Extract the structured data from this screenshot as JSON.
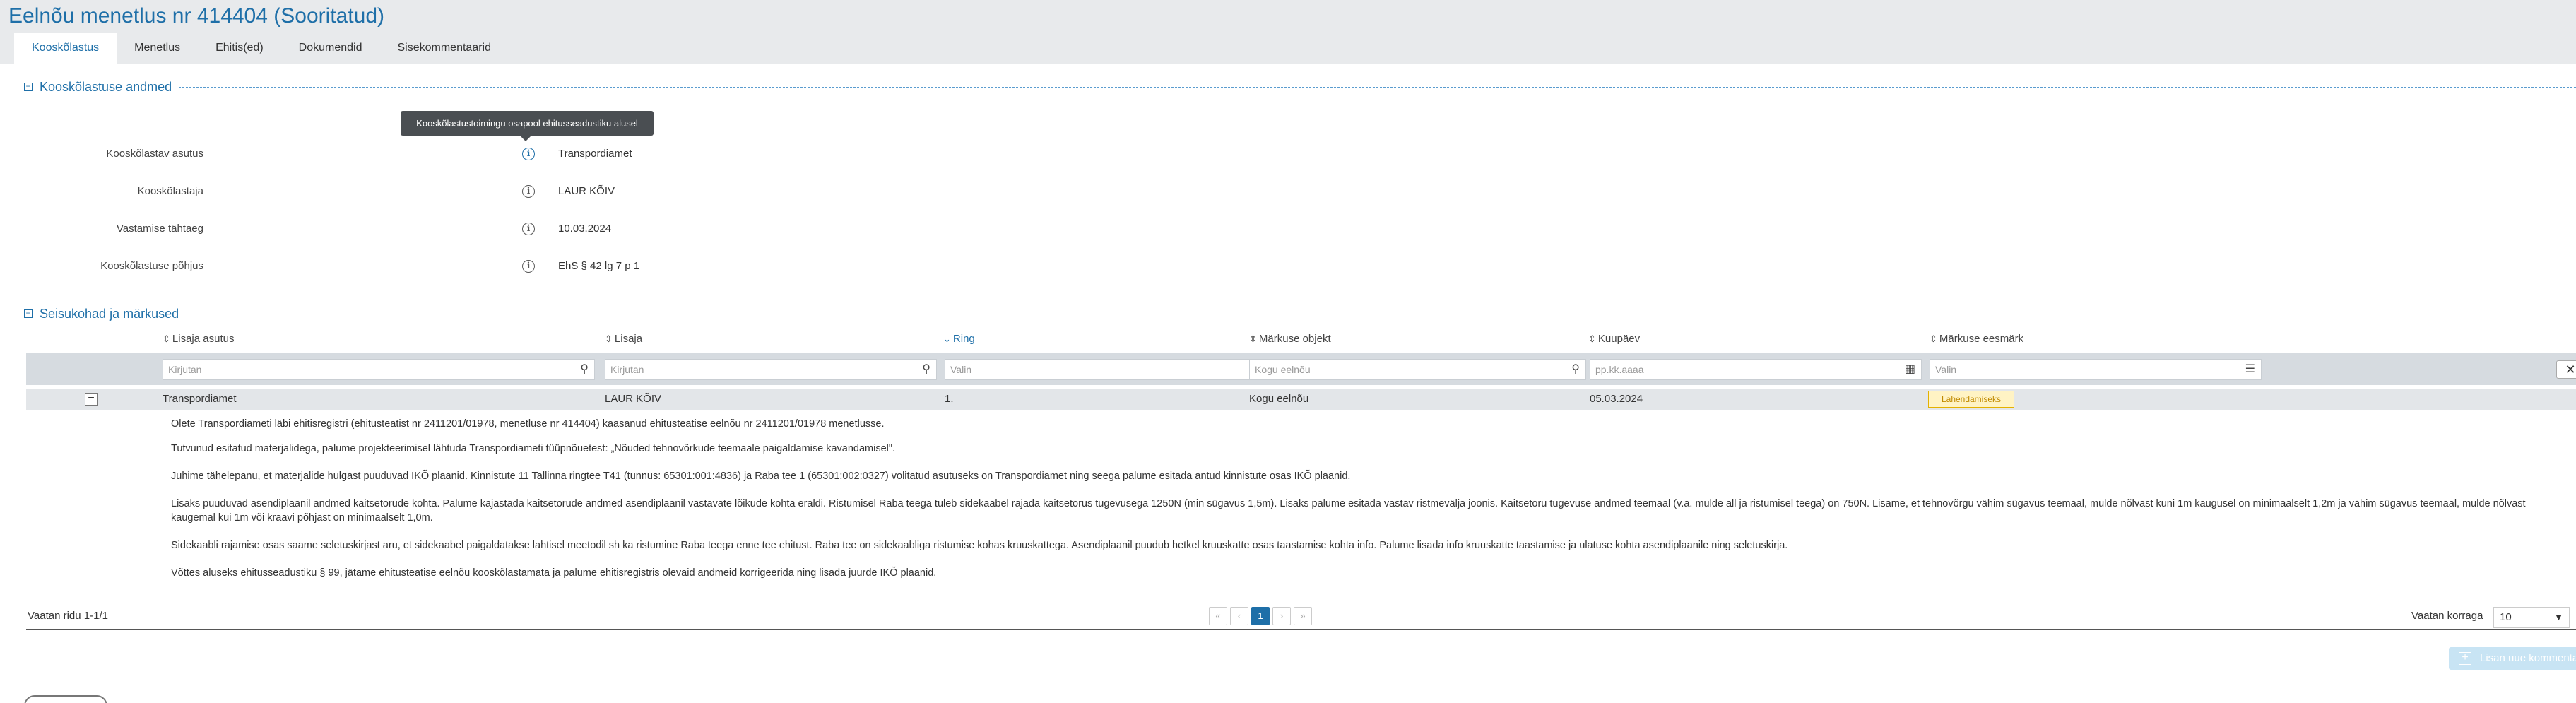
{
  "page": {
    "title": "Eelnõu menetlus nr 414404 (Sooritatud)"
  },
  "tabs": [
    {
      "label": "Kooskõlastus"
    },
    {
      "label": "Menetlus"
    },
    {
      "label": "Ehitis(ed)"
    },
    {
      "label": "Dokumendid"
    },
    {
      "label": "Sisekommentaarid"
    }
  ],
  "section1": {
    "title": "Kooskõlastuse andmed",
    "tooltip": "Kooskõlastustoimingu osapool ehitusseadustiku alusel",
    "fields": [
      {
        "label": "Kooskõlastav asutus",
        "value": "Transpordiamet"
      },
      {
        "label": "Kooskõlastaja",
        "value": "LAUR KÕIV"
      },
      {
        "label": "Vastamise tähtaeg",
        "value": "10.03.2024"
      },
      {
        "label": "Kooskõlastuse põhjus",
        "value": "EhS § 42 lg 7 p 1"
      }
    ]
  },
  "section2": {
    "title": "Seisukohad ja märkused",
    "columns": [
      {
        "label": "Lisaja asutus"
      },
      {
        "label": "Lisaja"
      },
      {
        "label": "Ring"
      },
      {
        "label": "Märkuse objekt"
      },
      {
        "label": "Kuupäev"
      },
      {
        "label": "Märkuse eesmärk"
      }
    ],
    "filters": [
      {
        "placeholder": "Kirjutan",
        "icon": "search-icon"
      },
      {
        "placeholder": "Kirjutan",
        "icon": "search-icon"
      },
      {
        "placeholder": "Valin",
        "icon": "list-icon"
      },
      {
        "placeholder": "Kogu eelnõu",
        "icon": "search-icon"
      },
      {
        "placeholder": "pp.kk.aaaa",
        "icon": "calendar-icon"
      },
      {
        "placeholder": "Valin",
        "icon": "list-icon"
      }
    ],
    "row": {
      "asutus": "Transpordiamet",
      "lisaja": "LAUR KÕIV",
      "ring": "1.",
      "objekt": "Kogu eelnõu",
      "kuupaev": "05.03.2024",
      "eesmark": "Lahendamiseks"
    },
    "comment": [
      "Olete Transpordiameti läbi ehitisregistri (ehitusteatist nr 2411201/01978, menetluse nr 414404) kaasanud ehitusteatise eelnõu nr 2411201/01978 menetlusse.",
      "Tutvunud esitatud materjalidega, palume projekteerimisel lähtuda Transpordiameti tüüpnõuetest: „Nõuded tehnovõrkude teemaale paigaldamise kavandamisel\".",
      "Juhime tähelepanu, et materjalide hulgast puuduvad IKÕ plaanid. Kinnistute 11 Tallinna ringtee T41 (tunnus: 65301:001:4836) ja Raba tee 1 (65301:002:0327) volitatud asutuseks on Transpordiamet ning seega palume esitada antud kinnistute osas IKÕ plaanid.",
      "Lisaks puuduvad asendiplaanil andmed kaitsetorude kohta. Palume kajastada kaitsetorude andmed asendiplaanil vastavate lõikude kohta eraldi. Ristumisel Raba teega tuleb sidekaabel rajada kaitsetorus tugevusega 1250N (min sügavus 1,5m). Lisaks palume esitada vastav ristmevälja joonis. Kaitsetoru tugevuse andmed teemaal (v.a. mulde all ja ristumisel teega) on 750N. Lisame, et tehnovõrgu vähim sügavus teemaal, mulde nõlvast kuni 1m kaugusel on minimaalselt 1,2m ja vähim sügavus teemaal, mulde nõlvast kaugemal kui 1m või kraavi põhjast on minimaalselt 1,0m.",
      "Sidekaabli rajamise osas saame seletuskirjast aru, et sidekaabel paigaldatakse lahtisel meetodil sh ka ristumine Raba teega enne tee ehitust. Raba tee on sidekaabliga ristumise kohas kruuskattega. Asendiplaanil puudub hetkel kruuskatte osas taastamise kohta info. Palume lisada info kruuskatte taastamise ja ulatuse kohta asendiplaanile ning seletuskirja.",
      "Võttes aluseks ehitusseadustiku § 99, jätame ehitusteatise eelnõu kooskõlastamata ja palume ehitisregistris olevaid andmeid korrigeerida ning lisada juurde IKÕ plaanid."
    ],
    "pager": {
      "summary": "Vaatan ridu 1-1/1",
      "first": "«",
      "prev": "‹",
      "current": "1",
      "next": "›",
      "last": "»",
      "per_page_label": "Vaatan korraga",
      "per_page_value": "10"
    },
    "add_comment": "Lisan uue kommentaari"
  },
  "colors": {
    "accent": "#1e6fa8",
    "badge_bg": "#fff3c4",
    "badge_border": "#e4b100"
  }
}
